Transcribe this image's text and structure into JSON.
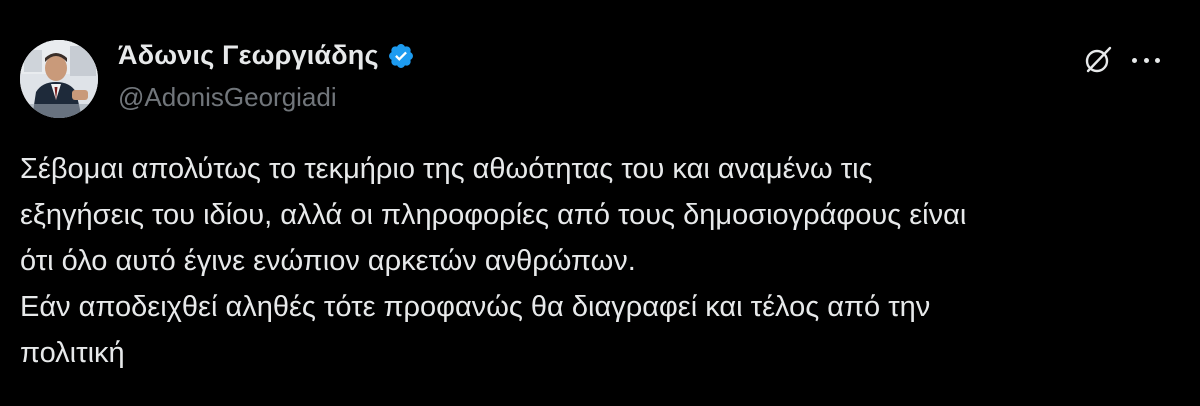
{
  "author": {
    "name": "Άδωνις Γεωργιάδης",
    "handle": "@AdonisGeorgiadi",
    "verified": true,
    "verified_color": "#1d9bf0"
  },
  "actions": {
    "grok_icon": "grok-icon",
    "more_icon": "more-icon"
  },
  "tweet": {
    "lines": [
      "Σέβομαι απολύτως το τεκμήριο της αθωότητας του και αναμένω τις",
      "εξηγήσεις του ιδίου, αλλά οι πληροφορίες από τους δημοσιογράφους είναι",
      "ότι όλο αυτό έγινε ενώπιον αρκετών ανθρώπων.",
      "Εάν αποδειχθεί αληθές τότε προφανώς θα διαγραφεί και τέλος από την",
      "πολιτική"
    ]
  },
  "colors": {
    "background": "#000000",
    "text": "#e7e9ea",
    "secondary": "#71767b"
  }
}
